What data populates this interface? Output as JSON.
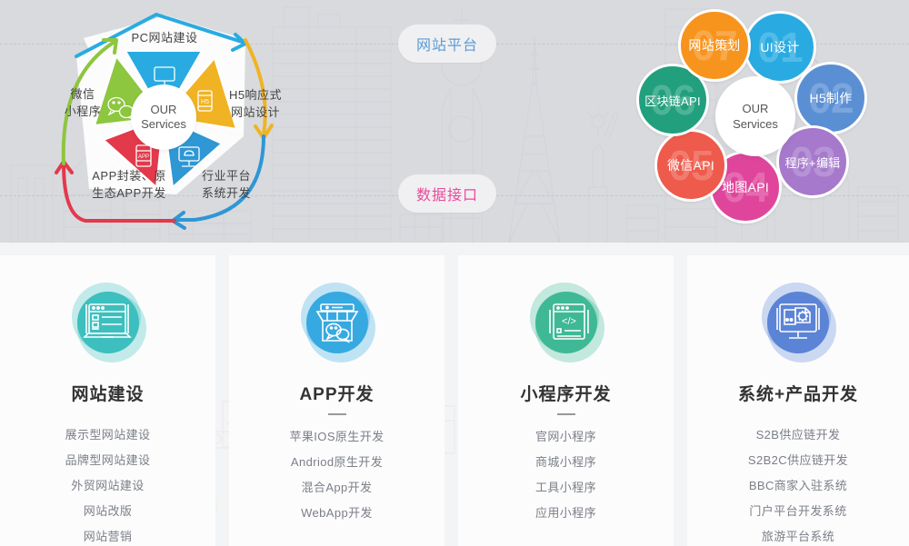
{
  "hero": {
    "center_labels": [
      {
        "text": "网站平台",
        "color": "#5a9bd5"
      },
      {
        "text": "数据接口",
        "color": "#ec4899"
      }
    ],
    "pentagon": {
      "center_line1": "OUR",
      "center_line2": "Services",
      "segments": [
        {
          "label": "PC网站建设",
          "color": "#29ABE2",
          "icon": "monitor-icon"
        },
        {
          "label": "H5响应式\n网站设计",
          "color": "#F0B323",
          "icon": "h5-phone-icon"
        },
        {
          "label": "行业平台\n系统开发",
          "color": "#2E97D4",
          "icon": "cloud-monitor-icon"
        },
        {
          "label": "APP封装、原\n生态APP开发",
          "color": "#E2394B",
          "icon": "app-phone-icon"
        },
        {
          "label": "微信\n小程序",
          "color": "#8DC63F",
          "icon": "wechat-icon"
        }
      ]
    },
    "circles": {
      "center_line1": "OUR",
      "center_line2": "Services",
      "items": [
        {
          "label": "UI设计",
          "number": "01",
          "color": "#29ABE2"
        },
        {
          "label": "H5制作",
          "number": "02",
          "color": "#5B8FD4"
        },
        {
          "label": "程序+编辑",
          "number": "03",
          "color": "#A679CC"
        },
        {
          "label": "地图API",
          "number": "04",
          "color": "#E0459C"
        },
        {
          "label": "微信API",
          "number": "05",
          "color": "#EE5A4B"
        },
        {
          "label": "区块链API",
          "number": "06",
          "color": "#22A07E"
        },
        {
          "label": "网站策划",
          "number": "07",
          "color": "#F7941E"
        }
      ]
    }
  },
  "cards": [
    {
      "title": "网站建设",
      "icon": "laptop-browser-icon",
      "color": "#3DBFBF",
      "items": [
        "展示型网站建设",
        "品牌型网站建设",
        "外贸网站建设",
        "网站改版",
        "网站营销"
      ]
    },
    {
      "title": "APP开发",
      "icon": "shop-wechat-icon",
      "color": "#36A9E1",
      "items": [
        "苹果IOS原生开发",
        "Andriod原生开发",
        "混合App开发",
        "WebApp开发"
      ]
    },
    {
      "title": "小程序开发",
      "icon": "code-window-icon",
      "color": "#3FB995",
      "items": [
        "官网小程序",
        "商城小程序",
        "工具小程序",
        "应用小程序"
      ]
    },
    {
      "title": "系统+产品开发",
      "icon": "desktop-gear-icon",
      "color": "#5B84D6",
      "items": [
        "S2B供应链开发",
        "S2B2C供应链开发",
        "BBC商家入驻系统",
        "门户平台开发系统",
        "旅游平台系统"
      ]
    }
  ]
}
